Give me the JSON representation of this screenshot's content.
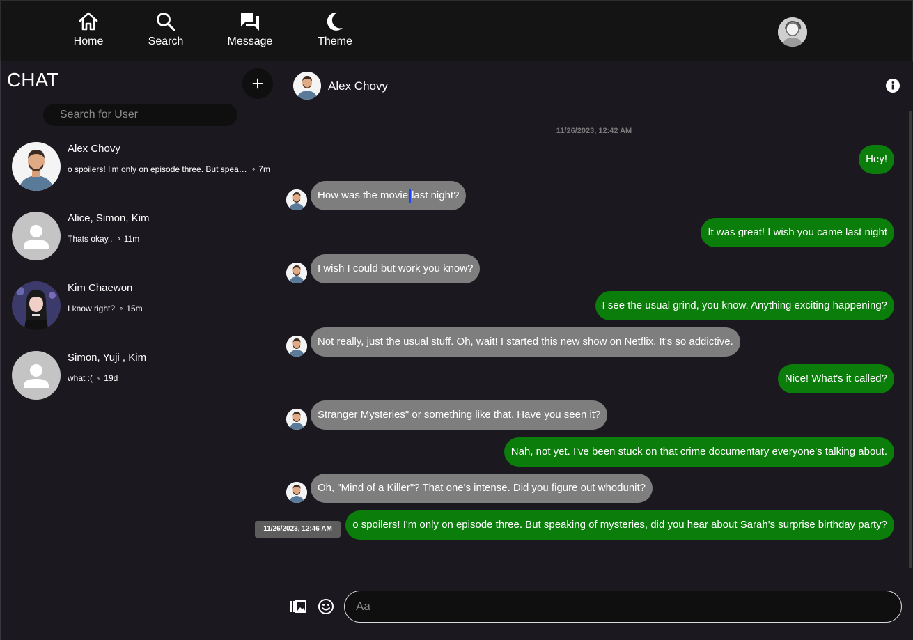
{
  "nav": {
    "items": [
      {
        "label": "Home",
        "icon": "home-icon"
      },
      {
        "label": "Search",
        "icon": "search-icon"
      },
      {
        "label": "Message",
        "icon": "message-icon"
      },
      {
        "label": "Theme",
        "icon": "moon-icon"
      }
    ]
  },
  "sidebar": {
    "title": "CHAT",
    "search_placeholder": "Search for User",
    "conversations": [
      {
        "name": "Alex Chovy",
        "preview": "o spoilers! I'm only on episode three. But speaking of mysteries, did you hear about Sarah's surprise birthday party?",
        "time": "7m",
        "avatar": "photo-man"
      },
      {
        "name": "Alice, Simon, Kim",
        "preview": "Thats okay..",
        "time": "11m",
        "avatar": "generic-user"
      },
      {
        "name": "Kim Chaewon",
        "preview": "I know right?",
        "time": "15m",
        "avatar": "photo-woman"
      },
      {
        "name": "Simon, Yuji , Kim",
        "preview": "what :(",
        "time": "19d",
        "avatar": "generic-user"
      }
    ]
  },
  "chat": {
    "contact_name": "Alex Chovy",
    "date_top": "11/26/2023, 12:42 AM",
    "tooltip_time": "11/26/2023, 12:46 AM",
    "messages": [
      {
        "from": "me",
        "text": "Hey!"
      },
      {
        "from": "them",
        "text_a": "How was the movie",
        "text_b": "last night?"
      },
      {
        "from": "me",
        "text": "It was great! I wish you came last night"
      },
      {
        "from": "them",
        "text": "I wish I could but work you know?"
      },
      {
        "from": "me",
        "text": "I see the usual grind, you know. Anything exciting happening?"
      },
      {
        "from": "them",
        "text": "Not really, just the usual stuff. Oh, wait! I started this new show on Netflix. It's so addictive."
      },
      {
        "from": "me",
        "text": "Nice! What's it called?"
      },
      {
        "from": "them",
        "text": "Stranger Mysteries\" or something like that. Have you seen it?"
      },
      {
        "from": "me",
        "text": "Nah, not yet. I've been stuck on that crime documentary everyone's talking about."
      },
      {
        "from": "them",
        "text": "Oh, \"Mind of a Killer\"? That one's intense. Did you figure out whodunit?"
      },
      {
        "from": "me",
        "text": "o spoilers! I'm only on episode three. But speaking of mysteries, did you hear about Sarah's surprise birthday party?"
      }
    ],
    "input_placeholder": "Aa"
  },
  "colors": {
    "outgoing_bubble": "#0a7d0a",
    "incoming_bubble": "#7e7e7e",
    "background": "#1c1820",
    "topbar": "#141414"
  }
}
